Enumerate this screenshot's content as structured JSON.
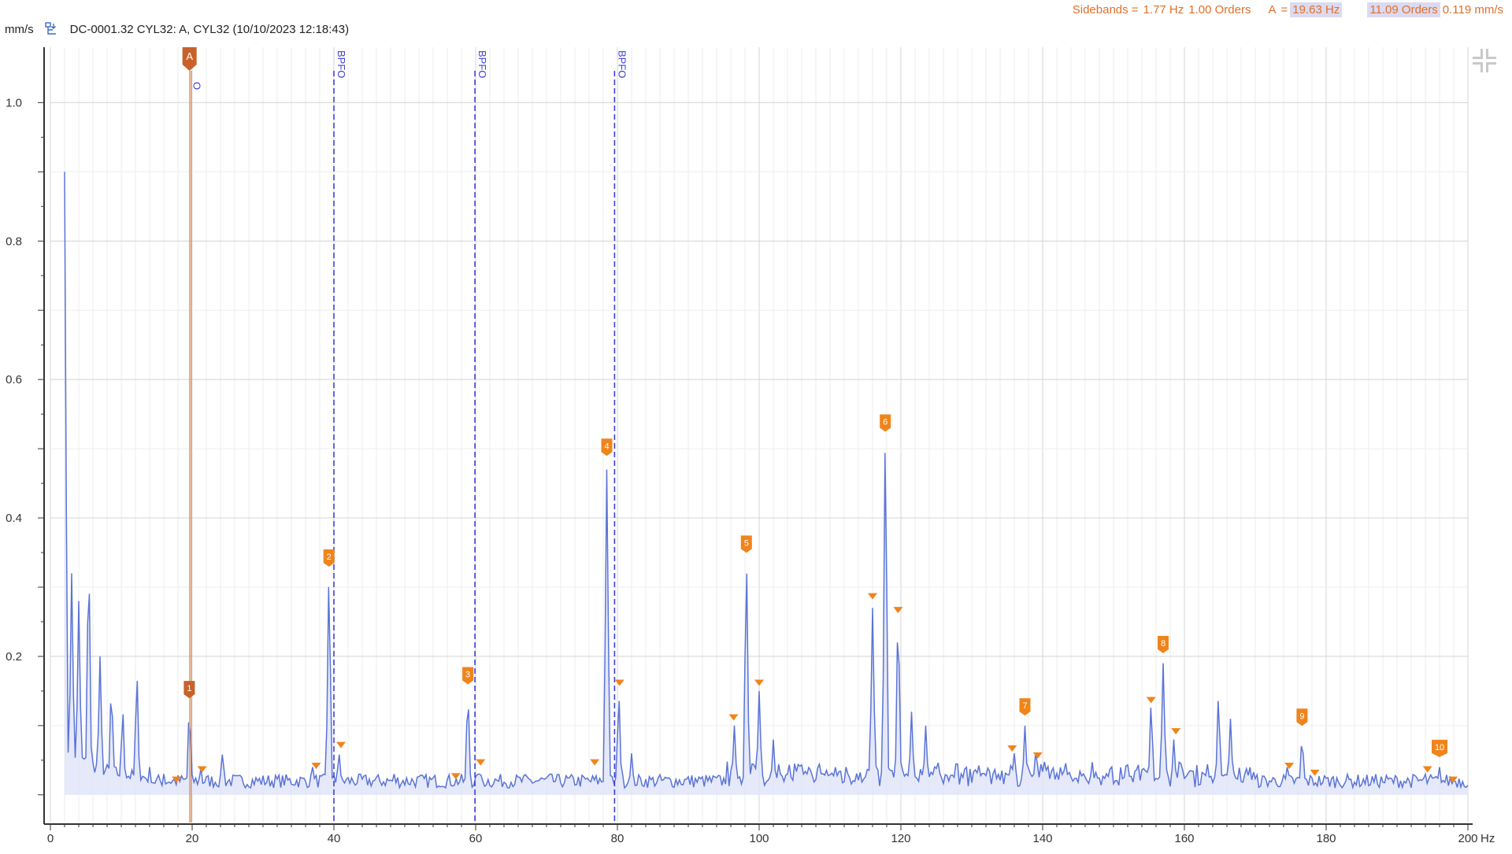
{
  "header": {
    "unit": "mm/s",
    "title": "DC-0001.32  CYL32: A, CYL32 (10/10/2023 12:18:43)",
    "icon": "download-tree-icon"
  },
  "readout": {
    "sidebands_label": "Sidebands =",
    "sidebands_hz": "1.77 Hz",
    "sidebands_orders": "1.00 Orders",
    "cursor_label": "A",
    "equals": "=",
    "cursor_hz": "19.63 Hz",
    "cursor_orders": "11.09 Orders",
    "cursor_amp": "0.119 mm/s"
  },
  "colors": {
    "trace": "#5b74d6",
    "fill": "#dfe4f7",
    "marker": "#f0841c",
    "cursor": "#c8612a",
    "bpfo": "#4040d8"
  },
  "chart_data": {
    "type": "line",
    "xlabel": "Hz",
    "ylabel": "mm/s",
    "xlim": [
      0,
      200
    ],
    "ylim": [
      -0.04,
      1.08
    ],
    "xticks": [
      0,
      20,
      40,
      60,
      80,
      100,
      120,
      140,
      160,
      180,
      200
    ],
    "yticks": [
      0.2,
      0.4,
      0.6,
      0.8,
      1.0
    ],
    "grid": true,
    "series": [
      {
        "peaks": [
          [
            2.0,
            0.9
          ],
          [
            3.0,
            0.32
          ],
          [
            4.0,
            0.28
          ],
          [
            5.4,
            0.33
          ],
          [
            7.0,
            0.2
          ],
          [
            8.6,
            0.15
          ],
          [
            10.2,
            0.12
          ],
          [
            12.2,
            0.17
          ],
          [
            14.0,
            0.04
          ],
          [
            16.0,
            0.03
          ],
          [
            19.6,
            0.119
          ],
          [
            21.2,
            0.04
          ],
          [
            24.3,
            0.06
          ],
          [
            37.0,
            0.04
          ],
          [
            39.3,
            0.31
          ],
          [
            40.7,
            0.06
          ],
          [
            48.5,
            0.03
          ],
          [
            58.9,
            0.14
          ],
          [
            60.5,
            0.03
          ],
          [
            70.5,
            0.03
          ],
          [
            78.5,
            0.47
          ],
          [
            80.2,
            0.14
          ],
          [
            82.0,
            0.06
          ],
          [
            96.5,
            0.1
          ],
          [
            98.2,
            0.33
          ],
          [
            100.0,
            0.15
          ],
          [
            102.0,
            0.08
          ],
          [
            116.0,
            0.27
          ],
          [
            117.8,
            0.51
          ],
          [
            119.6,
            0.25
          ],
          [
            121.5,
            0.12
          ],
          [
            123.5,
            0.1
          ],
          [
            136.0,
            0.06
          ],
          [
            137.5,
            0.1
          ],
          [
            139.0,
            0.06
          ],
          [
            155.3,
            0.13
          ],
          [
            157.0,
            0.19
          ],
          [
            158.5,
            0.08
          ],
          [
            164.8,
            0.14
          ],
          [
            166.5,
            0.11
          ],
          [
            174.5,
            0.04
          ],
          [
            176.6,
            0.08
          ],
          [
            194.0,
            0.03
          ],
          [
            196.0,
            0.04
          ]
        ]
      }
    ],
    "cursor": {
      "x": 19.63,
      "label": "A",
      "tag": "O"
    },
    "bpfo_lines": [
      {
        "x": 40.0,
        "label": "BPFO"
      },
      {
        "x": 59.9,
        "label": "BPFO"
      },
      {
        "x": 79.6,
        "label": "BPFO"
      }
    ],
    "harmonic_markers": [
      {
        "label": "1",
        "x": 19.6,
        "y": 0.135,
        "style": "cursor"
      },
      {
        "label": "2",
        "x": 39.3,
        "y": 0.325
      },
      {
        "label": "3",
        "x": 58.9,
        "y": 0.155
      },
      {
        "label": "4",
        "x": 78.5,
        "y": 0.485
      },
      {
        "label": "5",
        "x": 98.2,
        "y": 0.345
      },
      {
        "label": "6",
        "x": 117.8,
        "y": 0.52
      },
      {
        "label": "7",
        "x": 137.5,
        "y": 0.11
      },
      {
        "label": "8",
        "x": 157.0,
        "y": 0.2
      },
      {
        "label": "9",
        "x": 176.6,
        "y": 0.095
      },
      {
        "label": "10",
        "x": 196.0,
        "y": 0.05
      }
    ],
    "sideband_markers": [
      [
        17.8,
        0.015
      ],
      [
        21.4,
        0.03
      ],
      [
        37.5,
        0.035
      ],
      [
        41.0,
        0.065
      ],
      [
        57.2,
        0.02
      ],
      [
        60.7,
        0.04
      ],
      [
        76.8,
        0.04
      ],
      [
        80.3,
        0.155
      ],
      [
        96.4,
        0.105
      ],
      [
        100.0,
        0.155
      ],
      [
        116.0,
        0.28
      ],
      [
        119.6,
        0.26
      ],
      [
        135.7,
        0.06
      ],
      [
        139.3,
        0.05
      ],
      [
        155.3,
        0.13
      ],
      [
        158.8,
        0.085
      ],
      [
        174.8,
        0.035
      ],
      [
        178.4,
        0.025
      ],
      [
        194.3,
        0.03
      ],
      [
        197.9,
        0.015
      ]
    ]
  }
}
